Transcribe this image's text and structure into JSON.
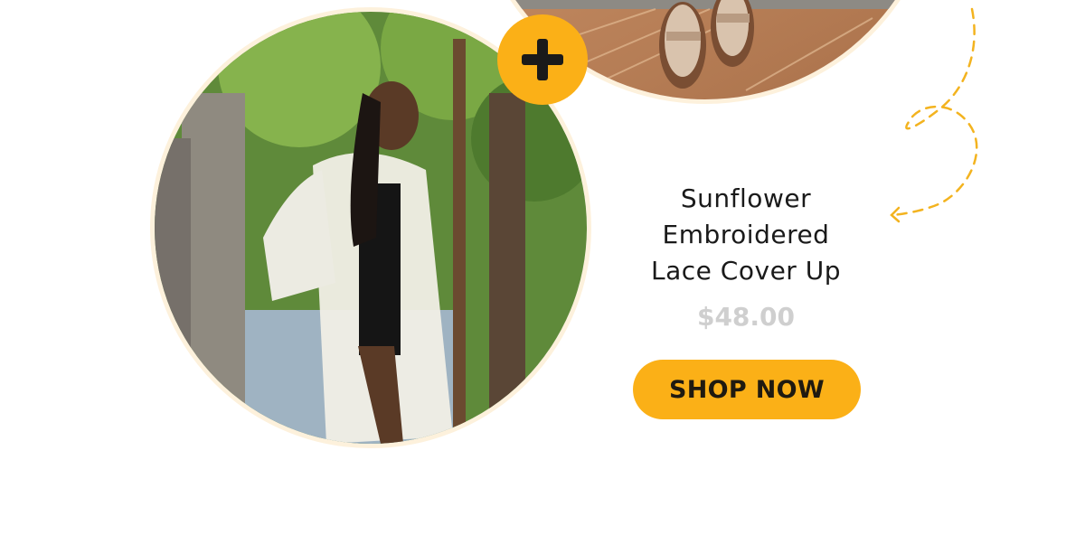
{
  "product": {
    "title_lines": [
      "Sunflower",
      "Embroidered",
      "Lace Cover Up"
    ],
    "price": "$48.00",
    "cta_label": "SHOP NOW"
  },
  "images": {
    "model_photo": "woman-in-white-lace-cover-up-among-trees",
    "sandal_photo": "sandals-on-woven-rug"
  },
  "icons": {
    "plus_badge": "plus-icon",
    "decoration": "dashed-arrow-icon"
  },
  "colors": {
    "accent": "#fbb017",
    "ring": "#fdf1dc",
    "title": "#1a1a1a",
    "price": "#cfcfcf"
  }
}
